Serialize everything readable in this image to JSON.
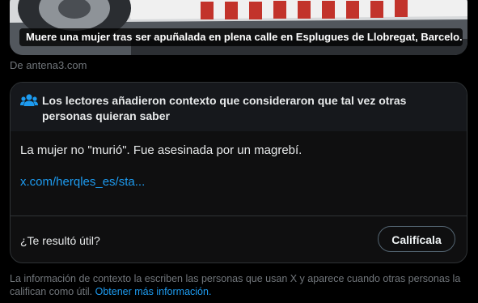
{
  "media": {
    "caption": "Muere una mujer tras ser apuñalada en plena calle en Esplugues de Llobregat, Barcelo...",
    "image_icon": "police-car-photo"
  },
  "source": {
    "label": "De antena3.com"
  },
  "community_note": {
    "icon": "people-icon",
    "title": "Los lectores añadieron contexto que consideraron que tal vez otras personas quieran saber",
    "body": "La mujer no \"murió\". Fue asesinada por un magrebí.",
    "link_text": "x.com/herqles_es/sta...",
    "helpful_question": "¿Te resultó útil?",
    "rate_button_label": "Califícala"
  },
  "footer": {
    "text": "La información de contexto la escriben las personas que usan X y aparece cuando otras personas la califican como útil.",
    "link_text": "Obtener más información."
  },
  "colors": {
    "background": "#000000",
    "accent_blue": "#1d9bf0",
    "muted_text": "#71767b",
    "border": "#2f3336"
  }
}
